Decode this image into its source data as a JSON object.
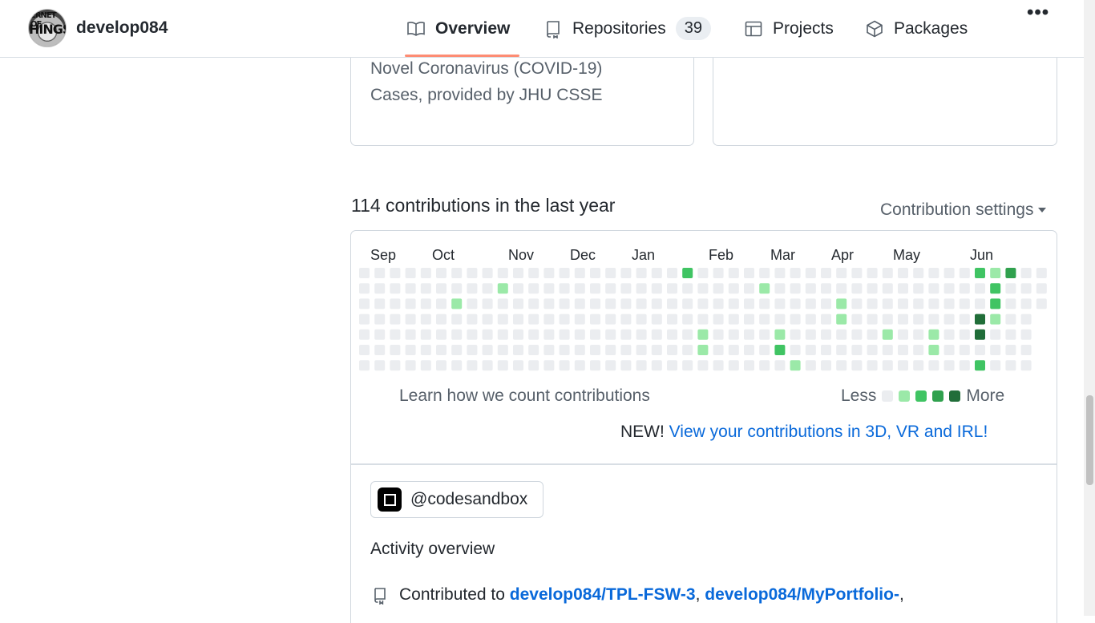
{
  "header": {
    "username": "develop084",
    "avatar_text_top": "ERNET OF",
    "avatar_text_main": "HINGS",
    "tabs": [
      {
        "label": "Overview",
        "icon": "book-icon",
        "active": true
      },
      {
        "label": "Repositories",
        "icon": "repo-icon",
        "count": "39"
      },
      {
        "label": "Projects",
        "icon": "table-icon"
      },
      {
        "label": "Packages",
        "icon": "package-icon"
      }
    ],
    "more_label": "•••"
  },
  "pinned": {
    "left_description": "Novel Coronavirus (COVID-19)\nCases, provided by JHU CSSE"
  },
  "contributions": {
    "title": "114 contributions in the last year",
    "settings_label": "Contribution settings",
    "months": [
      "Sep",
      "Oct",
      "Nov",
      "Dec",
      "Jan",
      "Feb",
      "Mar",
      "Apr",
      "May",
      "Jun"
    ],
    "learn_label": "Learn how we count contributions",
    "legend_less": "Less",
    "legend_more": "More",
    "legend_colors": [
      "#ebedf0",
      "#9be9a8",
      "#40c463",
      "#30a14e",
      "#216e39"
    ],
    "level_colors": [
      "#ebedf0",
      "#9be9a8",
      "#40c463",
      "#30a14e",
      "#216e39"
    ],
    "new_prefix": "NEW!",
    "new_link": "View your contributions in 3D, VR and IRL!",
    "weeks": 45,
    "active_days": [
      {
        "week": 21,
        "day": 0,
        "level": 2
      },
      {
        "week": 9,
        "day": 1,
        "level": 1
      },
      {
        "week": 6,
        "day": 2,
        "level": 1
      },
      {
        "week": 22,
        "day": 4,
        "level": 1
      },
      {
        "week": 22,
        "day": 5,
        "level": 1
      },
      {
        "week": 26,
        "day": 1,
        "level": 1
      },
      {
        "week": 27,
        "day": 4,
        "level": 1
      },
      {
        "week": 27,
        "day": 5,
        "level": 2
      },
      {
        "week": 28,
        "day": 6,
        "level": 1
      },
      {
        "week": 31,
        "day": 2,
        "level": 1
      },
      {
        "week": 31,
        "day": 3,
        "level": 1
      },
      {
        "week": 34,
        "day": 4,
        "level": 1
      },
      {
        "week": 37,
        "day": 4,
        "level": 1
      },
      {
        "week": 37,
        "day": 5,
        "level": 1
      },
      {
        "week": 40,
        "day": 0,
        "level": 2
      },
      {
        "week": 40,
        "day": 3,
        "level": 4
      },
      {
        "week": 40,
        "day": 4,
        "level": 4
      },
      {
        "week": 40,
        "day": 6,
        "level": 2
      },
      {
        "week": 41,
        "day": 0,
        "level": 1
      },
      {
        "week": 41,
        "day": 1,
        "level": 2
      },
      {
        "week": 41,
        "day": 2,
        "level": 2
      },
      {
        "week": 41,
        "day": 3,
        "level": 1
      },
      {
        "week": 42,
        "day": 0,
        "level": 3
      }
    ]
  },
  "activity": {
    "org_name": "@codesandbox",
    "title": "Activity overview",
    "contributed_prefix": "Contributed to",
    "repo1": "develop084/TPL-FSW-3",
    "sep1": ",",
    "repo2": "develop084/MyPortfolio-",
    "sep2": ","
  }
}
